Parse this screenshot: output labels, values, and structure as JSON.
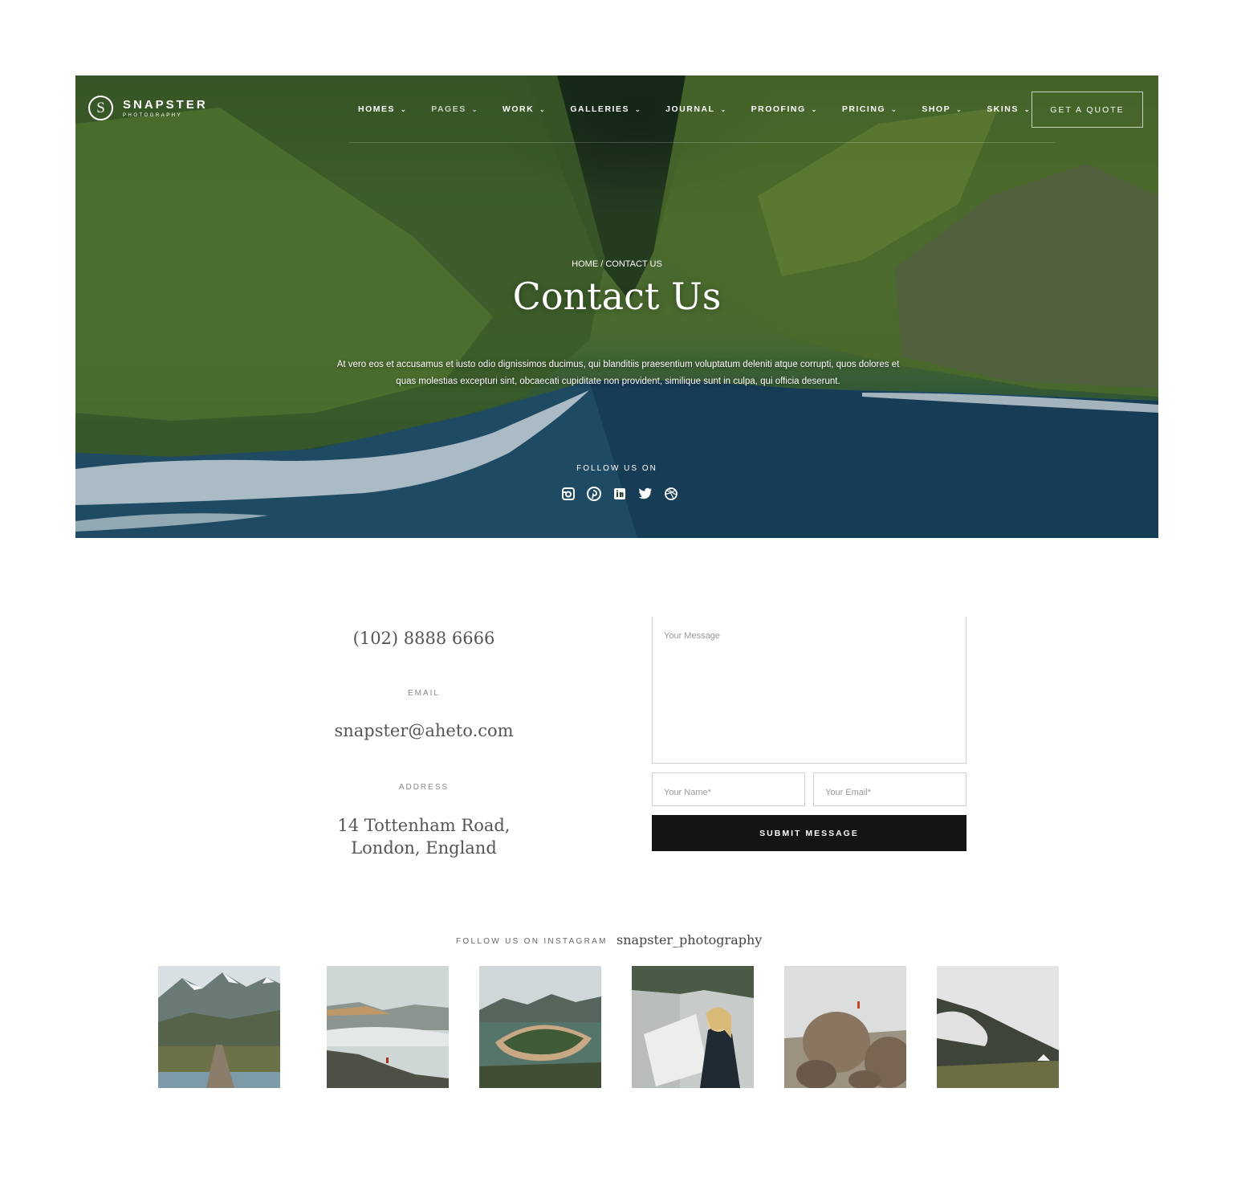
{
  "brand": {
    "name": "SNAPSTER",
    "tagline": "PHOTOGRAPHY",
    "mark": "S"
  },
  "nav": {
    "items": [
      {
        "label": "HOMES"
      },
      {
        "label": "PAGES"
      },
      {
        "label": "WORK"
      },
      {
        "label": "GALLERIES"
      },
      {
        "label": "JOURNAL"
      },
      {
        "label": "PROOFING"
      },
      {
        "label": "PRICING"
      },
      {
        "label": "SHOP"
      },
      {
        "label": "SKINS"
      }
    ],
    "quote_button": "GET A QUOTE"
  },
  "hero": {
    "breadcrumb": "HOME / CONTACT US",
    "title": "Contact Us",
    "description": "At vero eos et accusamus et iusto odio dignissimos ducimus, qui blanditiis praesentium voluptatum deleniti atque corrupti, quos dolores et quas molestias excepturi sint, obcaecati cupiditate non provident, similique sunt in culpa, qui officia deserunt.",
    "follow_label": "FOLLOW US ON",
    "socials": [
      "instagram-icon",
      "pinterest-icon",
      "linkedin-icon",
      "twitter-icon",
      "dribbble-icon"
    ]
  },
  "contact": {
    "phone": "(102) 8888 6666",
    "email_label": "EMAIL",
    "email": "snapster@aheto.com",
    "address_label": "ADDRESS",
    "address_line1": "14 Tottenham Road,",
    "address_line2": "London, England"
  },
  "form": {
    "message_placeholder": "Your Message",
    "name_placeholder": "Your Name*",
    "email_placeholder": "Your Email*",
    "submit_label": "SUBMIT MESSAGE"
  },
  "instagram": {
    "label": "FOLLOW US ON INSTAGRAM",
    "handle": "snapster_photography",
    "photos": [
      "mountain-bridge",
      "misty-peaks-hiker",
      "river-bend",
      "woman-with-map",
      "hiker-on-boulder",
      "foggy-hillside"
    ]
  },
  "colors": {
    "button_dark": "#141414",
    "border": "#cfcfcf",
    "muted_text": "#888888"
  }
}
